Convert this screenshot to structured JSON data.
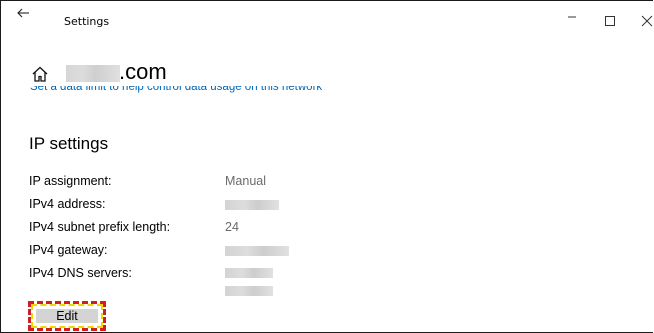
{
  "window": {
    "title": "Settings"
  },
  "header": {
    "network_name_visible_suffix": ".com",
    "data_limit_link": "Set a data limit to help control data usage on this network"
  },
  "ip_settings": {
    "title": "IP settings",
    "rows": [
      {
        "label": "IP assignment:",
        "value": "Manual"
      },
      {
        "label": "IPv4 address:",
        "value": ""
      },
      {
        "label": "IPv4 subnet prefix length:",
        "value": "24"
      },
      {
        "label": "IPv4 gateway:",
        "value": ""
      },
      {
        "label": "IPv4 DNS servers:",
        "value": ""
      }
    ],
    "edit_label": "Edit"
  },
  "icons": {
    "back": "arrow-left-icon",
    "home": "home-icon",
    "minimize": "minimize-icon",
    "maximize": "maximize-icon",
    "close": "close-icon"
  },
  "colors": {
    "link": "#0067b8",
    "value_text": "#6b6b6b",
    "button_bg": "#d4d4d4",
    "highlight_border": "#d11e1e",
    "highlight_inner": "#f2d600"
  }
}
